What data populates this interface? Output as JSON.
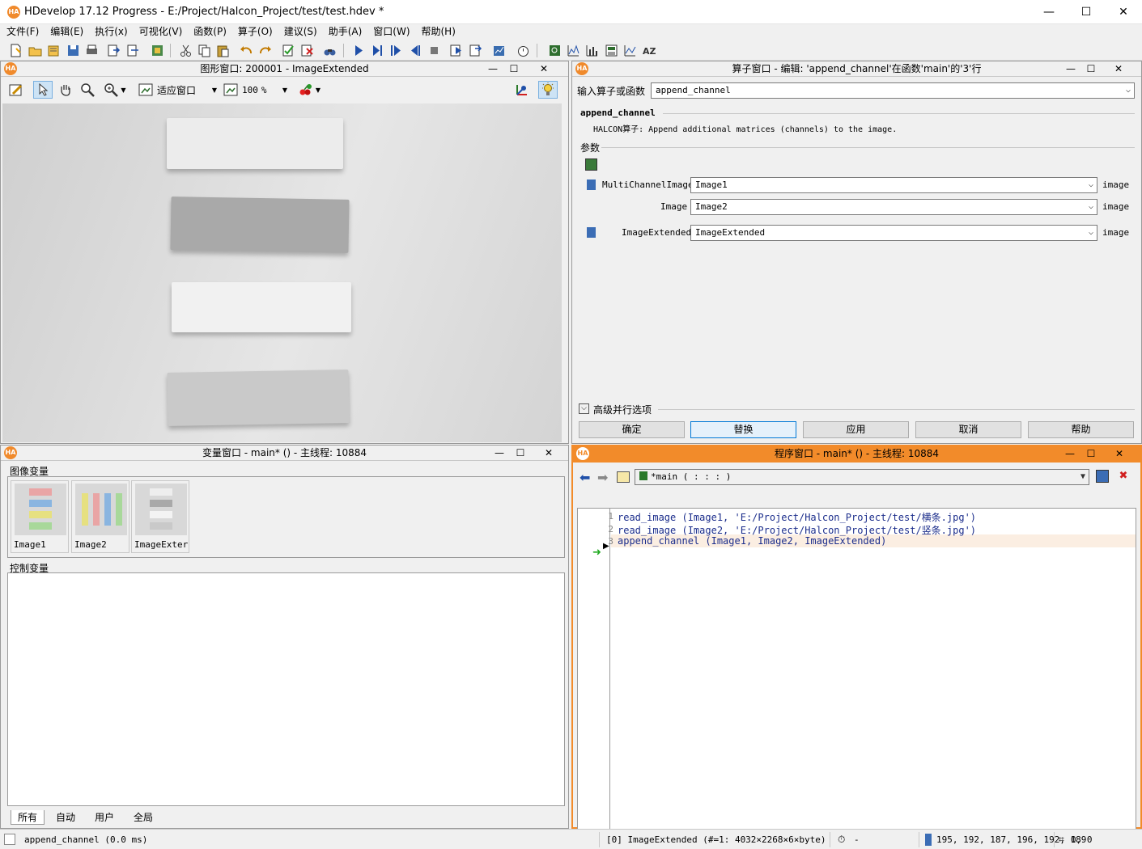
{
  "app": {
    "title": "HDevelop 17.12 Progress - E:/Project/Halcon_Project/test/test.hdev *",
    "logo": "HA",
    "window_controls": {
      "minimize": "—",
      "maximize": "☐",
      "close": "✕"
    }
  },
  "menu": [
    "文件(F)",
    "编辑(E)",
    "执行(x)",
    "可视化(V)",
    "函数(P)",
    "算子(O)",
    "建议(S)",
    "助手(A)",
    "窗口(W)",
    "帮助(H)"
  ],
  "graphics_window": {
    "title": "图形窗口: 200001 - ImageExtended",
    "fit_label": "适应窗口",
    "zoom_value": "100",
    "zoom_unit": "%"
  },
  "operator_window": {
    "title": "算子窗口 - 编辑: 'append_channel'在函数'main'的'3'行",
    "input_label": "输入算子或函数",
    "input_value": "append_channel",
    "op_name": "append_channel",
    "op_desc": "HALCON算子: Append additional matrices (channels) to the image.",
    "params_label": "参数",
    "params": [
      {
        "name": "MultiChannelImage",
        "value": "Image1",
        "type": "image"
      },
      {
        "name": "Image",
        "value": "Image2",
        "type": "image"
      },
      {
        "name": "ImageExtended",
        "value": "ImageExtended",
        "type": "image"
      }
    ],
    "advanced_label": "高级并行选项",
    "buttons": {
      "ok": "确定",
      "replace": "替换",
      "apply": "应用",
      "cancel": "取消",
      "help": "帮助"
    }
  },
  "variable_window": {
    "title": "变量窗口 - main* () - 主线程: 10884",
    "iconic_label": "图像变量",
    "iconic_vars": [
      "Image1",
      "Image2",
      "ImageExter"
    ],
    "control_label": "控制变量",
    "tabs": [
      "所有",
      "自动",
      "用户",
      "全局"
    ]
  },
  "program_window": {
    "title": "程序窗口 - main* () - 主线程: 10884",
    "procedure": "*main ( : : : )",
    "lines": [
      {
        "no": "1",
        "code": "read_image (Image1, 'E:/Project/Halcon_Project/test/横条.jpg')"
      },
      {
        "no": "2",
        "code": "read_image (Image2, 'E:/Project/Halcon_Project/test/竖条.jpg')"
      },
      {
        "no": "3",
        "code": "append_channel (Image1, Image2, ImageExtended)"
      }
    ]
  },
  "status": {
    "message": "append_channel (0.0 ms)",
    "image_info": "[0] ImageExtended (#=1: 4032×2268×6×byte)",
    "time": "-",
    "pixel_values": "195, 192, 187, 196, 192, 189",
    "coords": "0, 0"
  },
  "colors": {
    "accent_orange": "#f28b2a",
    "code_blue": "#1c2e8c",
    "active_arrow": "#22aa22"
  }
}
